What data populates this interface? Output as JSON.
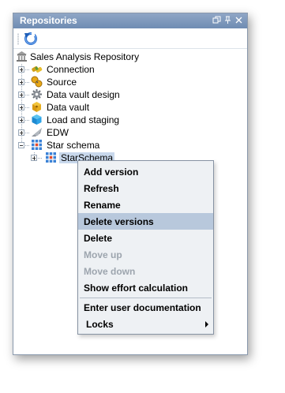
{
  "panel": {
    "title": "Repositories",
    "window_buttons": [
      "restore-icon",
      "pin-icon",
      "close-icon"
    ]
  },
  "toolbar": {
    "refresh_icon": "refresh-icon"
  },
  "tree": {
    "root": {
      "label": "Sales Analysis Repository",
      "icon": "repository-icon"
    },
    "items": [
      {
        "label": "Connection",
        "icon": "connection-icon",
        "expanded": false
      },
      {
        "label": "Source",
        "icon": "source-icon",
        "expanded": false
      },
      {
        "label": "Data vault design",
        "icon": "gear-icon",
        "expanded": false
      },
      {
        "label": "Data vault",
        "icon": "data-vault-icon",
        "expanded": false
      },
      {
        "label": "Load and staging",
        "icon": "cube-icon",
        "expanded": false
      },
      {
        "label": "EDW",
        "icon": "edw-icon",
        "expanded": false
      },
      {
        "label": "Star schema",
        "icon": "star-schema-icon",
        "expanded": true
      }
    ],
    "child": {
      "label": "StarSchema",
      "icon": "star-schema-icon",
      "selected": true
    }
  },
  "context_menu": {
    "items": [
      {
        "label": "Add version",
        "enabled": true
      },
      {
        "label": "Refresh",
        "enabled": true
      },
      {
        "label": "Rename",
        "enabled": true
      },
      {
        "label": "Delete versions",
        "enabled": true,
        "highlighted": true
      },
      {
        "label": "Delete",
        "enabled": true
      },
      {
        "label": "Move up",
        "enabled": false
      },
      {
        "label": "Move down",
        "enabled": false
      },
      {
        "label": "Show effort calculation",
        "enabled": true
      },
      {
        "label": "Enter user documentation",
        "enabled": true
      },
      {
        "label": "Locks",
        "enabled": true,
        "submenu": true
      }
    ]
  },
  "colors": {
    "titlebar": "#7b95bb",
    "menu_background": "#eef1f4",
    "menu_highlight": "#b8c8dc",
    "selection": "#c8d8ec",
    "disabled_text": "#9da5ae"
  }
}
